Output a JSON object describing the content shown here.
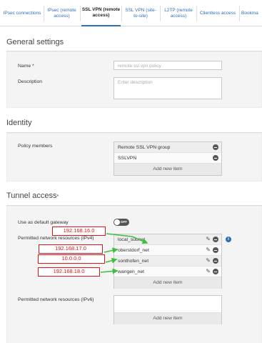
{
  "tabs": [
    {
      "label": "IPsec connections"
    },
    {
      "label": "IPsec (remote access)"
    },
    {
      "label": "SSL VPN (remote access)",
      "active": true
    },
    {
      "label": "SSL VPN (site-to-site)"
    },
    {
      "label": "L2TP (remote access)"
    },
    {
      "label": "Clientless access"
    },
    {
      "label": "Bookma"
    }
  ],
  "general": {
    "title": "General settings",
    "name_label": "Name *",
    "name_placeholder": "remote ssl vpn policy",
    "description_label": "Description",
    "description_placeholder": "Enter description"
  },
  "identity": {
    "title": "Identity",
    "members_label": "Policy members",
    "members": [
      "Remote SSL VPN group",
      "SSLVPN"
    ],
    "add_label": "Add new item"
  },
  "tunnel": {
    "title": "Tunnel access",
    "title_marker": "*",
    "gateway_label": "Use as default gateway",
    "toggle_text": "OFF",
    "ipv4_label": "Permitted network resources (IPv4)",
    "ipv4_items": [
      "local_subnet",
      "oberstdorf_net",
      "sonthofen_net",
      "wangen_net"
    ],
    "ipv4_add": "Add new item",
    "ipv6_label": "Permitted network resources (IPv6)",
    "ipv6_add": "Add new item",
    "info_glyph": "i"
  },
  "annotations": [
    "192.168.16.0",
    "192.168.17.0",
    "10.0.0.0",
    "192.168.18.0"
  ],
  "colors": {
    "accent": "#2c6fb7",
    "annotation": "#d9141a",
    "arrow": "#3fbf3f"
  }
}
